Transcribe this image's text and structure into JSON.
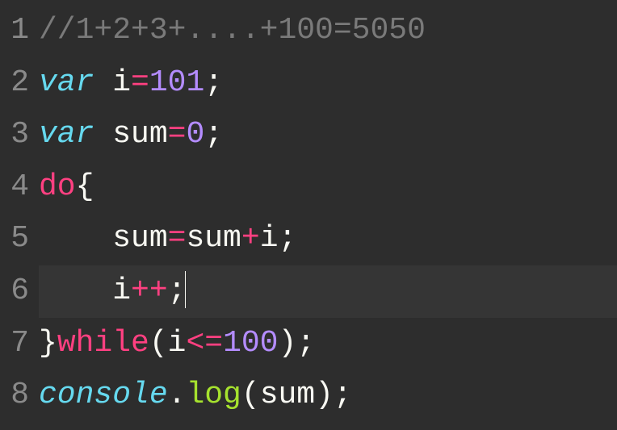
{
  "gutter": {
    "lines": [
      "1",
      "2",
      "3",
      "4",
      "5",
      "6",
      "7",
      "8"
    ]
  },
  "code": {
    "l1": {
      "comment": "//1+2+3+....+100=5050"
    },
    "l2": {
      "kw": "var",
      "sp": " ",
      "id": "i",
      "op": "=",
      "num": "101",
      "semi": ";"
    },
    "l3": {
      "kw": "var",
      "sp": " ",
      "id": "sum",
      "op": "=",
      "num": "0",
      "semi": ";"
    },
    "l4": {
      "kw": "do",
      "brace": "{"
    },
    "l5": {
      "indent": "    ",
      "id1": "sum",
      "op1": "=",
      "id2": "sum",
      "op2": "+",
      "id3": "i",
      "semi": ";"
    },
    "l6": {
      "indent": "    ",
      "id": "i",
      "op": "++",
      "semi": ";"
    },
    "l7": {
      "brace": "}",
      "kw": "while",
      "lp": "(",
      "id": "i",
      "op": "<=",
      "num": "100",
      "rp": ")",
      "semi": ";"
    },
    "l8": {
      "obj": "console",
      "dot": ".",
      "method": "log",
      "lp": "(",
      "id": "sum",
      "rp": ")",
      "semi": ";"
    }
  }
}
